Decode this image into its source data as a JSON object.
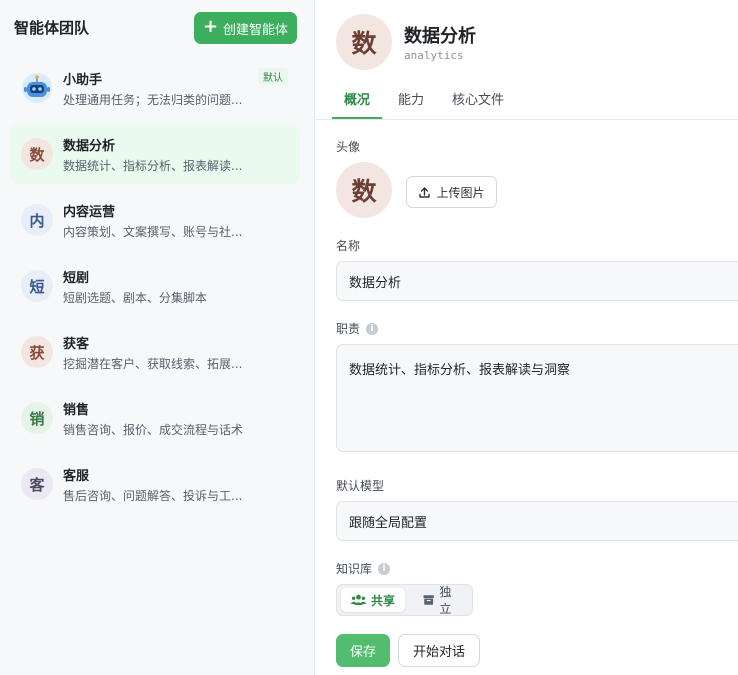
{
  "sidebar": {
    "title": "智能体团队",
    "create_label": "创建智能体",
    "agents": [
      {
        "name": "小助手",
        "desc": "处理通用任务；无法归类的问题...",
        "avatar": "",
        "badge": "默认"
      },
      {
        "name": "数据分析",
        "desc": "数据统计、指标分析、报表解读...",
        "avatar": "数"
      },
      {
        "name": "内容运营",
        "desc": "内容策划、文案撰写、账号与社...",
        "avatar": "内"
      },
      {
        "name": "短剧",
        "desc": "短剧选题、剧本、分集脚本",
        "avatar": "短"
      },
      {
        "name": "获客",
        "desc": "挖掘潜在客户、获取线索、拓展...",
        "avatar": "获"
      },
      {
        "name": "销售",
        "desc": "销售咨询、报价、成交流程与话术",
        "avatar": "销"
      },
      {
        "name": "客服",
        "desc": "售后咨询、问题解答、投诉与工...",
        "avatar": "客"
      }
    ]
  },
  "header": {
    "avatar": "数",
    "name": "数据分析",
    "id": "analytics"
  },
  "tabs": [
    "概况",
    "能力",
    "核心文件"
  ],
  "form": {
    "avatar_label": "头像",
    "avatar_char": "数",
    "upload_label": "上传图片",
    "name_label": "名称",
    "name_value": "数据分析",
    "duty_label": "职责",
    "duty_value": "数据统计、指标分析、报表解读与洞察",
    "model_label": "默认模型",
    "model_value": "跟随全局配置",
    "kb_label": "知识库",
    "kb_shared": "共享",
    "kb_independent": "独立"
  },
  "actions": {
    "save": "保存",
    "start_chat": "开始对话"
  },
  "colors": {
    "accent": "#3dae5e",
    "active_bg": "#eafaee"
  }
}
